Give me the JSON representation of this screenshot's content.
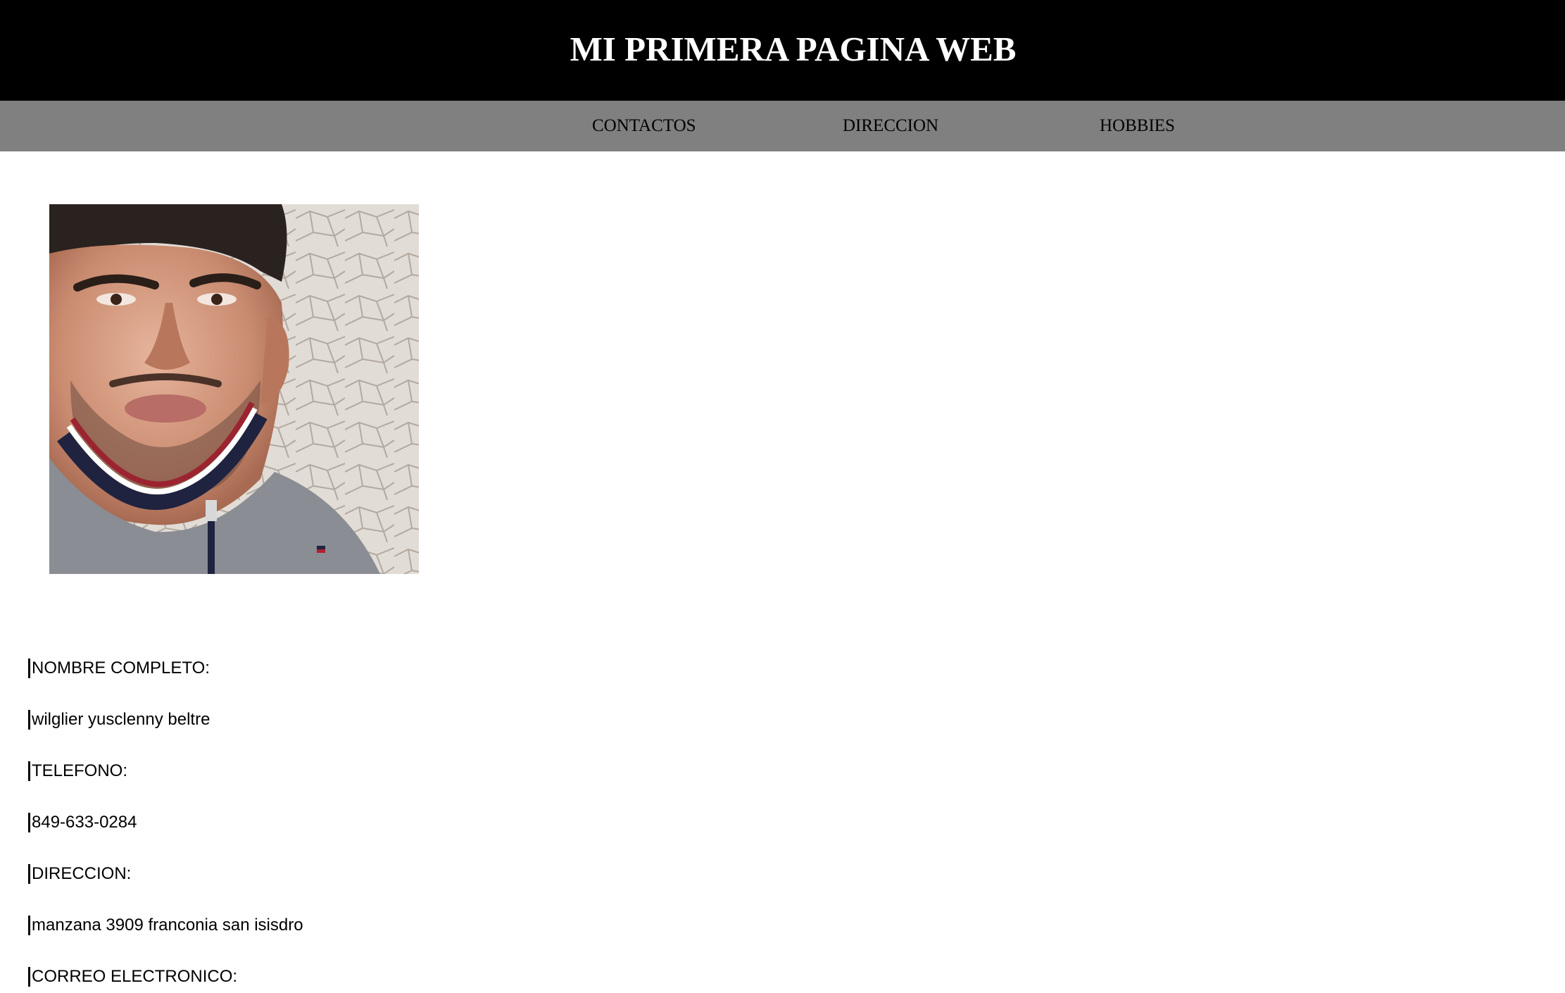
{
  "header": {
    "title": "MI PRIMERA PAGINA WEB"
  },
  "nav": {
    "items": [
      {
        "label": "CONTACTOS"
      },
      {
        "label": "DIRECCION"
      },
      {
        "label": "HOBBIES"
      }
    ]
  },
  "profile": {
    "photo_icon": "profile-photo",
    "fields": [
      {
        "text": "NOMBRE COMPLETO:"
      },
      {
        "text": "wilglier yusclenny beltre"
      },
      {
        "text": "TELEFONO:"
      },
      {
        "text": "849-633-0284"
      },
      {
        "text": "DIRECCION:"
      },
      {
        "text": "manzana 3909 franconia san isisdro"
      },
      {
        "text": "CORREO ELECTRONICO:"
      }
    ]
  },
  "colors": {
    "header_bg": "#000000",
    "nav_bg": "#808080",
    "title": "#ffffff"
  }
}
